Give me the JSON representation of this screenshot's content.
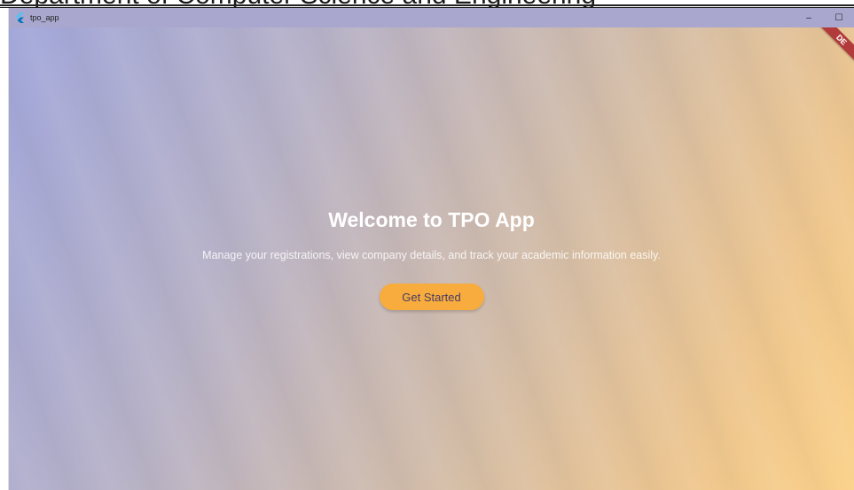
{
  "background": {
    "partial_heading": "Department of Computer Science and Engineering"
  },
  "window": {
    "title": "tpo_app",
    "controls": {
      "minimize": "–",
      "maximize": "☐"
    },
    "debug_ribbon": "DE"
  },
  "main": {
    "title": "Welcome to TPO App",
    "subtitle": "Manage your registrations, view company details, and track your academic information easily.",
    "cta_label": "Get Started"
  },
  "colors": {
    "titlebar": "#a9a7ce",
    "gradient_start": "#a2a7da",
    "gradient_end": "#fbd18a",
    "button": "#f7ac3d",
    "button_text": "#4a3b63",
    "ribbon": "#b23a3a"
  },
  "icons": {
    "app_icon": "flutter-icon",
    "minimize": "minimize-icon",
    "maximize": "maximize-icon"
  }
}
